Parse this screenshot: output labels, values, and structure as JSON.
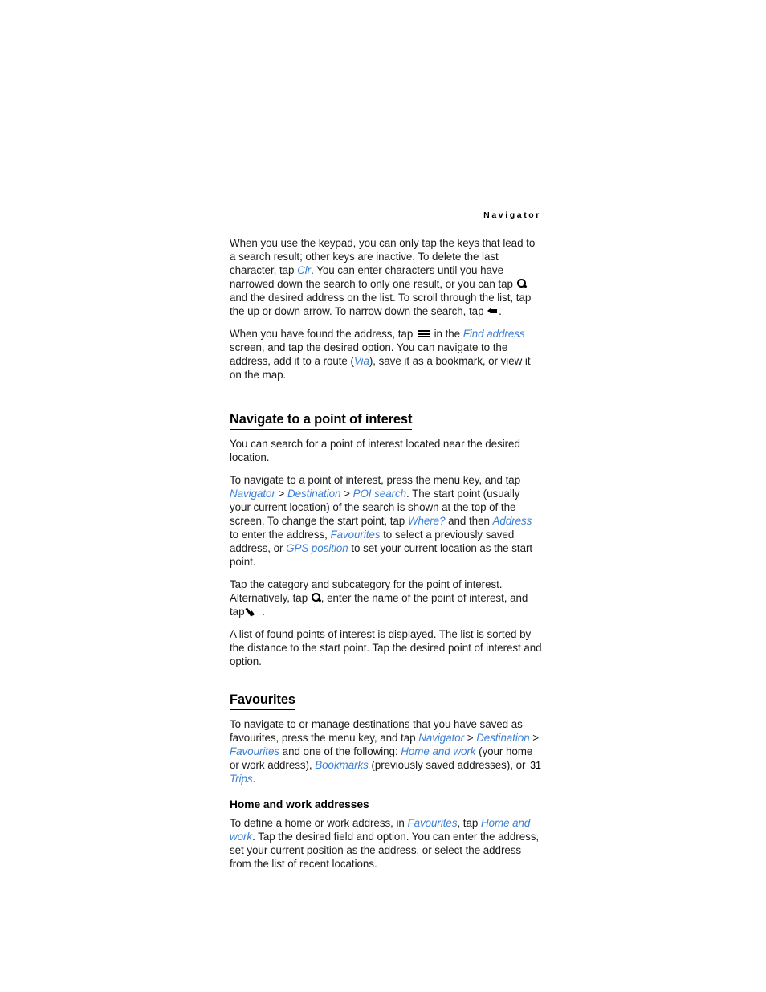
{
  "header": {
    "running_title": "Navigator"
  },
  "footer": {
    "page_number": "31"
  },
  "icons": {
    "search": "search-icon",
    "left_arrow": "left-arrow-icon",
    "menu": "menu-icon",
    "check": "check-icon"
  },
  "colors": {
    "ui_reference": "#3b7fd4",
    "body_text": "#1a1a1a",
    "heading": "#000000"
  },
  "content": {
    "p1": {
      "seg1": "When you use the keypad, you can only tap the keys that lead to a search result; other keys are inactive. To delete the last character, tap ",
      "ui1": "Clr",
      "seg2": ". You can enter characters until you have narrowed down the search to only one result, or you can tap ",
      "seg3": " and the desired address on the list. To scroll through the list, tap the up or down arrow. To narrow down the search, tap ",
      "seg4": "."
    },
    "p2": {
      "seg1": "When you have found the address, tap ",
      "seg2": " in the ",
      "ui1": "Find address",
      "seg3": " screen, and tap the desired option. You can navigate to the address, add it to a route (",
      "ui2": "Via",
      "seg4": "), save it as a bookmark, or view it on the map."
    },
    "h1": "Navigate to a point of interest",
    "p3": "You can search for a point of interest located near the desired location.",
    "p4": {
      "seg1": "To navigate to a point of interest, press the menu key, and tap ",
      "ui1": "Navigator",
      "sep1": " > ",
      "ui2": "Destination",
      "sep2": " > ",
      "ui3": "POI search",
      "seg2": ". The start point (usually your current location) of the search is shown at the top of the screen. To change the start point, tap ",
      "ui4": "Where?",
      "seg3": " and then ",
      "ui5": "Address",
      "seg4": " to enter the address, ",
      "ui6": "Favourites",
      "seg5": " to select a previously saved address, or ",
      "ui7": "GPS position",
      "seg6": " to set your current location as the start point."
    },
    "p5": {
      "seg1": "Tap the category and subcategory for the point of interest. Alternatively, tap ",
      "seg2": ", enter the name of the point of interest, and tap ",
      "seg3": "."
    },
    "p6": "A list of found points of interest is displayed. The list is sorted by the distance to the start point. Tap the desired point of interest and option.",
    "h2": "Favourites",
    "p7": {
      "seg1": "To navigate to or manage destinations that you have saved as favourites, press the menu key, and tap ",
      "ui1": "Navigator",
      "sep1": " > ",
      "ui2": "Destination",
      "sep2": " > ",
      "ui3": "Favourites",
      "seg2": " and one of the following: ",
      "ui4": "Home and work",
      "seg3": " (your home or work address), ",
      "ui5": "Bookmarks",
      "seg4": " (previously saved addresses), or ",
      "ui6": "Trips",
      "seg5": "."
    },
    "h3": "Home and work addresses",
    "p8": {
      "seg1": "To define a home or work address, in ",
      "ui1": "Favourites",
      "seg2": ", tap ",
      "ui2": "Home and work",
      "seg3": ". Tap the desired field and option. You can enter the address, set your current position as the address, or select the address from the list of recent locations."
    }
  }
}
